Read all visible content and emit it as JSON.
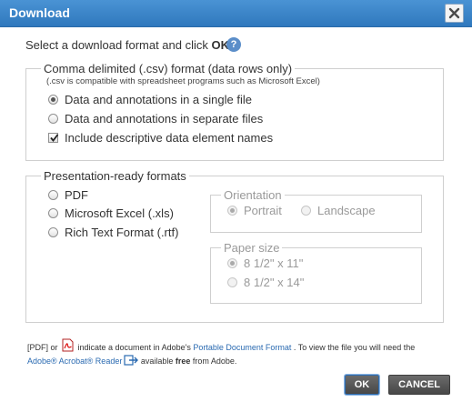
{
  "dialog": {
    "title": "Download",
    "close_icon": "close-icon"
  },
  "intro": {
    "text_before": "Select a download format and click ",
    "ok_word": "OK",
    "text_after": ".",
    "help_icon": "question-mark-icon",
    "help_glyph": "?"
  },
  "csv": {
    "legend": "Comma delimited (.csv) format (data rows only)",
    "note": "(.csv is compatible with spreadsheet programs such as Microsoft Excel)",
    "options": [
      {
        "label": "Data and annotations in a single file",
        "selected": true
      },
      {
        "label": "Data and annotations in separate files",
        "selected": false
      }
    ],
    "include_names": {
      "label": "Include descriptive data element names",
      "checked": true
    }
  },
  "presentation": {
    "legend": "Presentation-ready formats",
    "formats": [
      {
        "label": "PDF",
        "selected": false
      },
      {
        "label": "Microsoft Excel (.xls)",
        "selected": false
      },
      {
        "label": "Rich Text Format (.rtf)",
        "selected": false
      }
    ],
    "orientation": {
      "legend": "Orientation",
      "options": [
        {
          "label": "Portrait",
          "selected": true
        },
        {
          "label": "Landscape",
          "selected": false
        }
      ]
    },
    "paper_size": {
      "legend": "Paper size",
      "options": [
        {
          "label": "8 1/2\" x 11\"",
          "selected": true
        },
        {
          "label": "8 1/2\" x 14\"",
          "selected": false
        }
      ]
    }
  },
  "footer": {
    "part1": "[PDF] or ",
    "part2": " indicate a document in Adobe's ",
    "pdf_link": "Portable Document Format",
    "part3": " . To view the file you will need the",
    "reader_link": "Adobe® Acrobat® Reader",
    "part4": " available ",
    "free_word": "free",
    "part5": " from Adobe.",
    "pdf_icon": "pdf-file-icon",
    "external_icon": "external-link-icon"
  },
  "buttons": {
    "ok": "OK",
    "cancel": "CANCEL"
  },
  "colors": {
    "titlebar": "#3a85c9",
    "link": "#2a6ab1",
    "button": "#5a5a5a"
  }
}
